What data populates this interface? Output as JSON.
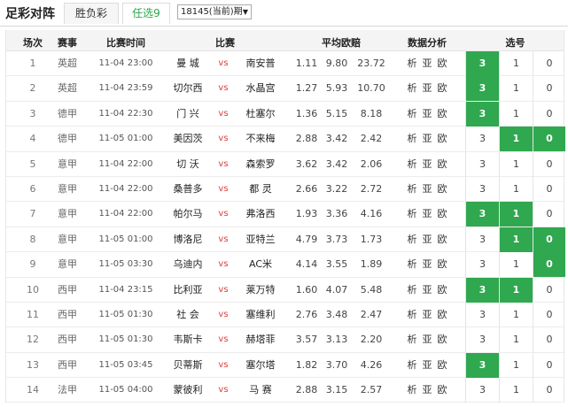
{
  "app": {
    "title": "足彩对阵",
    "tabs": [
      {
        "label": "胜负彩",
        "active": false
      },
      {
        "label": "任选9",
        "active": true
      }
    ],
    "period": "18145(当前)期",
    "accent_color": "#2fa84f",
    "vs_color": "#e23b3b"
  },
  "table": {
    "headers": {
      "idx": "场次",
      "league": "赛事",
      "time": "比赛时间",
      "match": "比赛",
      "odds": "平均欧赔",
      "analysis": "数据分析",
      "pick": "选号"
    },
    "vs_text": "vs",
    "analysis_links": [
      "析",
      "亚",
      "欧"
    ],
    "pick_labels": [
      "3",
      "1",
      "0"
    ],
    "rows": [
      {
        "idx": "1",
        "league": "英超",
        "time": "11-04 23:00",
        "home": "曼 城",
        "away": "南安普",
        "odds": [
          "1.11",
          "9.80",
          "23.72"
        ],
        "picks": [
          true,
          false,
          false
        ]
      },
      {
        "idx": "2",
        "league": "英超",
        "time": "11-04 23:59",
        "home": "切尔西",
        "away": "水晶宫",
        "odds": [
          "1.27",
          "5.93",
          "10.70"
        ],
        "picks": [
          true,
          false,
          false
        ]
      },
      {
        "idx": "3",
        "league": "德甲",
        "time": "11-04 22:30",
        "home": "门 兴",
        "away": "杜塞尔",
        "odds": [
          "1.36",
          "5.15",
          "8.18"
        ],
        "picks": [
          true,
          false,
          false
        ]
      },
      {
        "idx": "4",
        "league": "德甲",
        "time": "11-05 01:00",
        "home": "美因茨",
        "away": "不来梅",
        "odds": [
          "2.88",
          "3.42",
          "2.42"
        ],
        "picks": [
          false,
          true,
          true
        ]
      },
      {
        "idx": "5",
        "league": "意甲",
        "time": "11-04 22:00",
        "home": "切 沃",
        "away": "森索罗",
        "odds": [
          "3.62",
          "3.42",
          "2.06"
        ],
        "picks": [
          false,
          false,
          false
        ]
      },
      {
        "idx": "6",
        "league": "意甲",
        "time": "11-04 22:00",
        "home": "桑普多",
        "away": "都 灵",
        "odds": [
          "2.66",
          "3.22",
          "2.72"
        ],
        "picks": [
          false,
          false,
          false
        ]
      },
      {
        "idx": "7",
        "league": "意甲",
        "time": "11-04 22:00",
        "home": "帕尔马",
        "away": "弗洛西",
        "odds": [
          "1.93",
          "3.36",
          "4.16"
        ],
        "picks": [
          true,
          true,
          false
        ]
      },
      {
        "idx": "8",
        "league": "意甲",
        "time": "11-05 01:00",
        "home": "博洛尼",
        "away": "亚特兰",
        "odds": [
          "4.79",
          "3.73",
          "1.73"
        ],
        "picks": [
          false,
          true,
          true
        ]
      },
      {
        "idx": "9",
        "league": "意甲",
        "time": "11-05 03:30",
        "home": "乌迪内",
        "away": "AC米",
        "odds": [
          "4.14",
          "3.55",
          "1.89"
        ],
        "picks": [
          false,
          false,
          true
        ]
      },
      {
        "idx": "10",
        "league": "西甲",
        "time": "11-04 23:15",
        "home": "比利亚",
        "away": "莱万特",
        "odds": [
          "1.60",
          "4.07",
          "5.48"
        ],
        "picks": [
          true,
          true,
          false
        ]
      },
      {
        "idx": "11",
        "league": "西甲",
        "time": "11-05 01:30",
        "home": "社 会",
        "away": "塞维利",
        "odds": [
          "2.76",
          "3.48",
          "2.47"
        ],
        "picks": [
          false,
          false,
          false
        ]
      },
      {
        "idx": "12",
        "league": "西甲",
        "time": "11-05 01:30",
        "home": "韦斯卡",
        "away": "赫塔菲",
        "odds": [
          "3.57",
          "3.13",
          "2.20"
        ],
        "picks": [
          false,
          false,
          false
        ]
      },
      {
        "idx": "13",
        "league": "西甲",
        "time": "11-05 03:45",
        "home": "贝蒂斯",
        "away": "塞尔塔",
        "odds": [
          "1.82",
          "3.70",
          "4.26"
        ],
        "picks": [
          true,
          false,
          false
        ]
      },
      {
        "idx": "14",
        "league": "法甲",
        "time": "11-05 04:00",
        "home": "蒙彼利",
        "away": "马 赛",
        "odds": [
          "2.88",
          "3.15",
          "2.57"
        ],
        "picks": [
          false,
          false,
          false
        ]
      }
    ]
  }
}
